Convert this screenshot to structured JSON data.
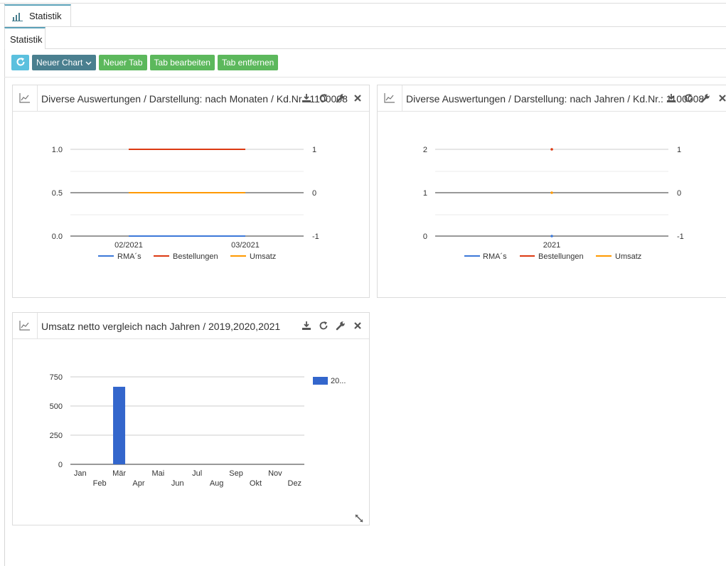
{
  "outer_tab": {
    "label": "Statistik",
    "icon": "bar-chart-icon"
  },
  "inner_tab": {
    "label": "Statistik"
  },
  "toolbar": {
    "refresh_icon": "refresh-icon",
    "new_chart": "Neuer Chart",
    "new_tab": "Neuer Tab",
    "edit_tab": "Tab bearbeiten",
    "remove_tab": "Tab entfernen",
    "colors": {
      "refresh": "#5bc0de",
      "new_chart": "#4a7f8f",
      "tabs": "#5cb85c"
    }
  },
  "panels": {
    "monthly": {
      "title": "Diverse Auswertungen / Darstellung: nach Monaten / Kd.Nr.: 1100008",
      "chart_data": {
        "type": "line",
        "x": [
          "02/2021",
          "03/2021"
        ],
        "y_left_ticks": [
          "1.0",
          "0.5",
          "0.0"
        ],
        "y_right_ticks": [
          "1",
          "0",
          "-1"
        ],
        "ylim_left": [
          0,
          1
        ],
        "ylim_right": [
          -1,
          1
        ],
        "series": [
          {
            "name": "RMA´s",
            "color": "#3c78d8",
            "values": [
              0,
              0
            ]
          },
          {
            "name": "Bestellungen",
            "color": "#dc3912",
            "values": [
              1,
              1
            ]
          },
          {
            "name": "Umsatz",
            "color": "#ff9900",
            "values": [
              0,
              0
            ]
          }
        ],
        "legend_position": "bottom"
      }
    },
    "yearly": {
      "title": "Diverse Auswertungen / Darstellung: nach Jahren / Kd.Nr.: 1100008",
      "chart_data": {
        "type": "line",
        "x": [
          "2021"
        ],
        "y_left_ticks": [
          "2",
          "1",
          "0"
        ],
        "y_right_ticks": [
          "1",
          "0",
          "-1"
        ],
        "ylim_left": [
          0,
          2
        ],
        "ylim_right": [
          -1,
          1
        ],
        "series": [
          {
            "name": "RMA´s",
            "color": "#3c78d8",
            "values": [
              0
            ]
          },
          {
            "name": "Bestellungen",
            "color": "#dc3912",
            "values": [
              2
            ]
          },
          {
            "name": "Umsatz",
            "color": "#ff9900",
            "values": [
              0
            ]
          }
        ],
        "legend_position": "bottom"
      }
    },
    "revenue": {
      "title": "Umsatz netto vergleich nach Jahren / 2019,2020,2021",
      "chart_data": {
        "type": "bar",
        "categories": [
          "Jan",
          "Feb",
          "Mär",
          "Apr",
          "Mai",
          "Jun",
          "Jul",
          "Aug",
          "Sep",
          "Okt",
          "Nov",
          "Dez"
        ],
        "series": [
          {
            "name": "20...",
            "color": "#3366cc",
            "values": [
              0,
              0,
              665,
              0,
              0,
              0,
              0,
              0,
              0,
              0,
              0,
              0
            ]
          }
        ],
        "y_ticks": [
          "750",
          "500",
          "250",
          "0"
        ],
        "ylim": [
          0,
          750
        ],
        "legend_position": "right"
      }
    }
  },
  "panel_tools": [
    "download-icon",
    "refresh-icon",
    "wrench-icon",
    "close-icon"
  ]
}
